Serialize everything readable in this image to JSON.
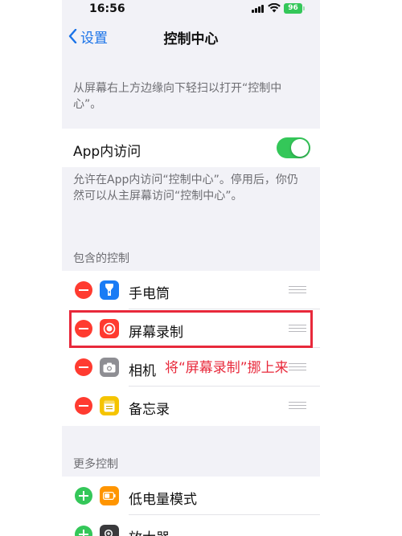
{
  "status_bar": {
    "time": "16:56",
    "battery": "96"
  },
  "nav": {
    "back_label": "设置",
    "title": "控制中心"
  },
  "top_note": "从屏幕右上方边缘向下轻扫以打开“控制中心”。",
  "access_toggle": {
    "label": "App内访问",
    "on": true
  },
  "access_note": "允许在App内访问“控制中心”。停用后，你仍然可以从主屏幕访问“控制中心”。",
  "included": {
    "header": "包含的控制",
    "items": [
      {
        "label": "手电筒",
        "icon": "flashlight-icon",
        "color": "#1a7cf5"
      },
      {
        "label": "屏幕录制",
        "icon": "screen-record-icon",
        "color": "#ff3b30"
      },
      {
        "label": "相机",
        "icon": "camera-icon",
        "color": "#8e8e93"
      },
      {
        "label": "备忘录",
        "icon": "notes-icon",
        "color": "#f5c400"
      }
    ]
  },
  "more": {
    "header": "更多控制",
    "items": [
      {
        "label": "低电量模式",
        "icon": "battery-icon",
        "color": "#ff9500"
      },
      {
        "label": "放大器",
        "icon": "magnifier-icon",
        "color": "#3a3a3c"
      }
    ]
  },
  "annotation": "将“屏幕录制”挪上来",
  "colors": {
    "accent": "#1a73e8",
    "highlight": "#e8293b",
    "toggle_on": "#34c759"
  }
}
